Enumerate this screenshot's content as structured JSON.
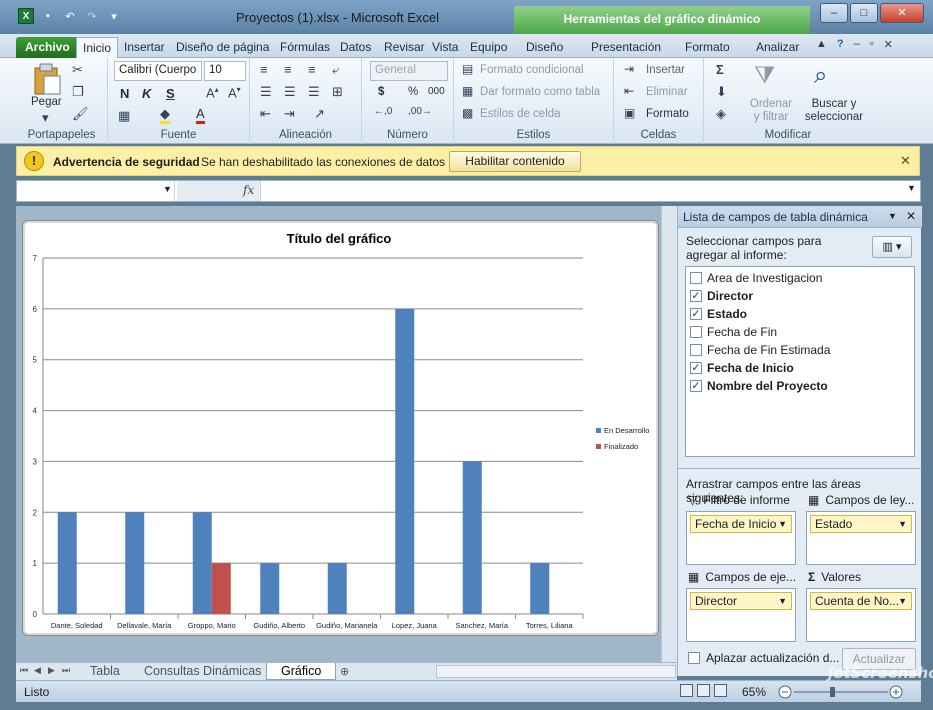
{
  "window": {
    "title": "Proyectos (1).xlsx  -  Microsoft Excel",
    "context_tools": "Herramientas del gráfico dinámico",
    "controls": [
      "–",
      "□",
      "✕"
    ]
  },
  "tabs": {
    "items": [
      "Archivo",
      "Inicio",
      "Insertar",
      "Diseño de página",
      "Fórmulas",
      "Datos",
      "Revisar",
      "Vista",
      "Equipo",
      "Diseño",
      "Presentación",
      "Formato",
      "Analizar"
    ]
  },
  "ribbon": {
    "clipboard": {
      "paste": "Pegar",
      "label": "Portapapeles"
    },
    "font": {
      "family": "Calibri (Cuerpo",
      "size": "10",
      "bold": "N",
      "italic": "K",
      "underline": "S",
      "label": "Fuente"
    },
    "alignment": {
      "label": "Alineación"
    },
    "number": {
      "format": "General",
      "currency": "$",
      "percent": "%",
      "thousands": "000",
      "label": "Número"
    },
    "styles": {
      "conditional": "Formato condicional",
      "table": "Dar formato como tabla",
      "cell_styles": "Estilos de celda",
      "label": "Estilos"
    },
    "cells": {
      "insert": "Insertar",
      "delete": "Eliminar",
      "format": "Formato",
      "label": "Celdas"
    },
    "editing": {
      "sort": "Ordenar y filtrar",
      "find": "Buscar y seleccionar",
      "label": "Modificar"
    }
  },
  "security": {
    "title": "Advertencia de seguridad",
    "message": "Se han deshabilitado las conexiones de datos",
    "button": "Habilitar contenido"
  },
  "formula": {
    "name_box": "",
    "fx": "fx",
    "content": ""
  },
  "chart_data": {
    "type": "bar",
    "title": "Título del gráfico",
    "categories": [
      "Dante, Soledad",
      "Dellavale, María",
      "Groppo, Mario",
      "Gudiño, Alberto",
      "Gudiño, Marianela",
      "Lopez, Juana",
      "Sanchez, María",
      "Torres, Liliana"
    ],
    "series": [
      {
        "name": "En Desarrollo",
        "color": "#4f81bd",
        "values": [
          2,
          2,
          2,
          1,
          1,
          6,
          3,
          1
        ]
      },
      {
        "name": "Finalizado",
        "color": "#c0504d",
        "values": [
          0,
          0,
          1,
          0,
          0,
          0,
          0,
          0
        ]
      }
    ],
    "ylim": [
      0,
      7
    ],
    "yticks": [
      "0",
      "1",
      "2",
      "3",
      "4",
      "5",
      "6",
      "7"
    ],
    "grid": true,
    "legend": "right"
  },
  "sheets": {
    "tabs": [
      "Tabla",
      "Consultas Dinámicas",
      "Gráfico"
    ],
    "active": "Gráfico"
  },
  "pivot": {
    "title": "Lista de campos de tabla dinámica",
    "instruction": "Seleccionar campos para agregar al informe:",
    "fields": [
      {
        "label": "Area de Investigacion",
        "checked": false
      },
      {
        "label": "Director",
        "checked": true
      },
      {
        "label": "Estado",
        "checked": true
      },
      {
        "label": "Fecha de Fin",
        "checked": false
      },
      {
        "label": "Fecha de Fin Estimada",
        "checked": false
      },
      {
        "label": "Fecha de Inicio",
        "checked": true
      },
      {
        "label": "Nombre del Proyecto",
        "checked": true
      }
    ],
    "areas_instruction": "Arrastrar campos entre las áreas siguientes:",
    "filter_title": "Filtro de informe",
    "legend_title": "Campos de ley...",
    "axis_title": "Campos de eje...",
    "values_title": "Valores",
    "filter_chip": "Fecha de Inicio",
    "legend_chip": "Estado",
    "axis_chip": "Director",
    "values_chip": "Cuenta de No...",
    "defer_label": "Aplazar actualización d...",
    "update_btn": "Actualizar"
  },
  "status": {
    "text": "Listo",
    "zoom": "65%"
  },
  "watermark": "jetScreenshot"
}
